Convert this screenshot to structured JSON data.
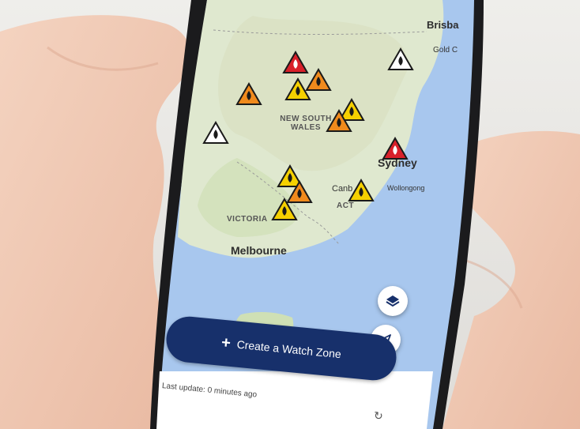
{
  "map": {
    "labels": {
      "nsw": "NEW SOUTH WALES",
      "victoria": "VICTORIA",
      "act": "ACT",
      "melbourne": "Melbourne",
      "sydney": "Sydney",
      "canberra": "Canb",
      "wollongong": "Wollongong",
      "brisbane": "Brisba",
      "gold_coast": "Gold C"
    },
    "marker_colors": {
      "emergency": "#d9202a",
      "watch_and_act": "#f08a1c",
      "advice": "#f5d000",
      "planned_burn": "#ffffff"
    }
  },
  "controls": {
    "layers_icon": "layers-icon",
    "locate_icon": "location-arrow-icon",
    "refresh_icon": "refresh-icon"
  },
  "watch_zone": {
    "plus": "+",
    "label": "Create a Watch Zone"
  },
  "status": {
    "last_update": "Last update: 0 minutes ago"
  },
  "colors": {
    "primary": "#17306b",
    "map_land": "#dfe8cf",
    "map_water": "#a8c7ee"
  }
}
